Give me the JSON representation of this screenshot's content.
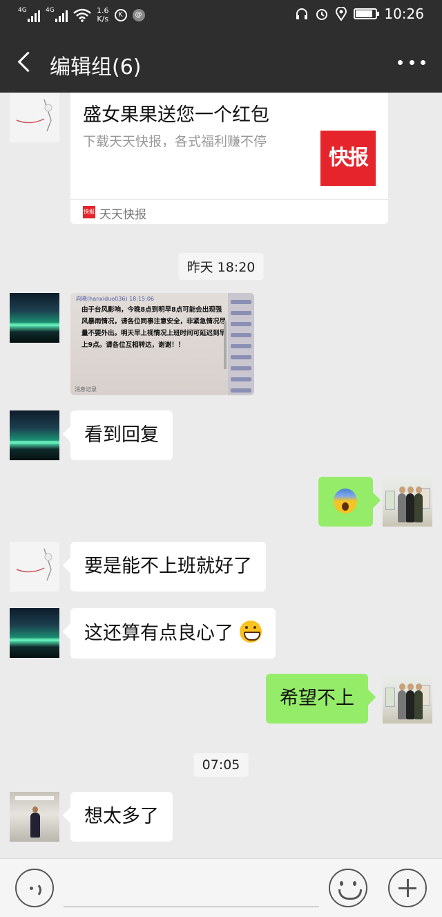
{
  "status_bar": {
    "net1": "4G",
    "net2": "4G",
    "speed_value": "1.6",
    "speed_unit": "K/s",
    "icon_k": "K",
    "icon_misc": "@",
    "time": "10:26",
    "battery_level": 0.85
  },
  "header": {
    "title": "编辑组(6)",
    "back_icon": "chevron-left-icon",
    "more_icon": "more-dots-icon"
  },
  "link_card": {
    "title": "盛女果果送您一个红包",
    "description": "下载天天快报，各式福利赚不停",
    "thumb_text": "快报",
    "source_icon_text": "快报",
    "source_name": "天天快报"
  },
  "timestamps": [
    "昨天 18:20",
    "07:05"
  ],
  "image_message": {
    "header": "向晓(hanxiduo036)  18:15:06",
    "text": "由于台风影响，今晚8点到明早8点可能会出现强风暴雨情况，请各位同事注意安全，非紧急情况尽量不要外出。明天早上视情况上班时间可延迟到早上9点。请各位互相转达，谢谢！！",
    "footer": "消息记录"
  },
  "messages": [
    {
      "text": "看到回复"
    },
    {
      "text": "",
      "emoji": "screaming-face-emoji"
    },
    {
      "text": "要是能不上班就好了"
    },
    {
      "text": "这还算有点良心了",
      "emoji": "grinning-face-emoji"
    },
    {
      "text": "希望不上"
    },
    {
      "text": "想太多了"
    }
  ],
  "input_bar": {
    "voice_icon": "voice-icon",
    "emoji_icon": "emoji-icon",
    "plus_icon": "plus-icon"
  }
}
